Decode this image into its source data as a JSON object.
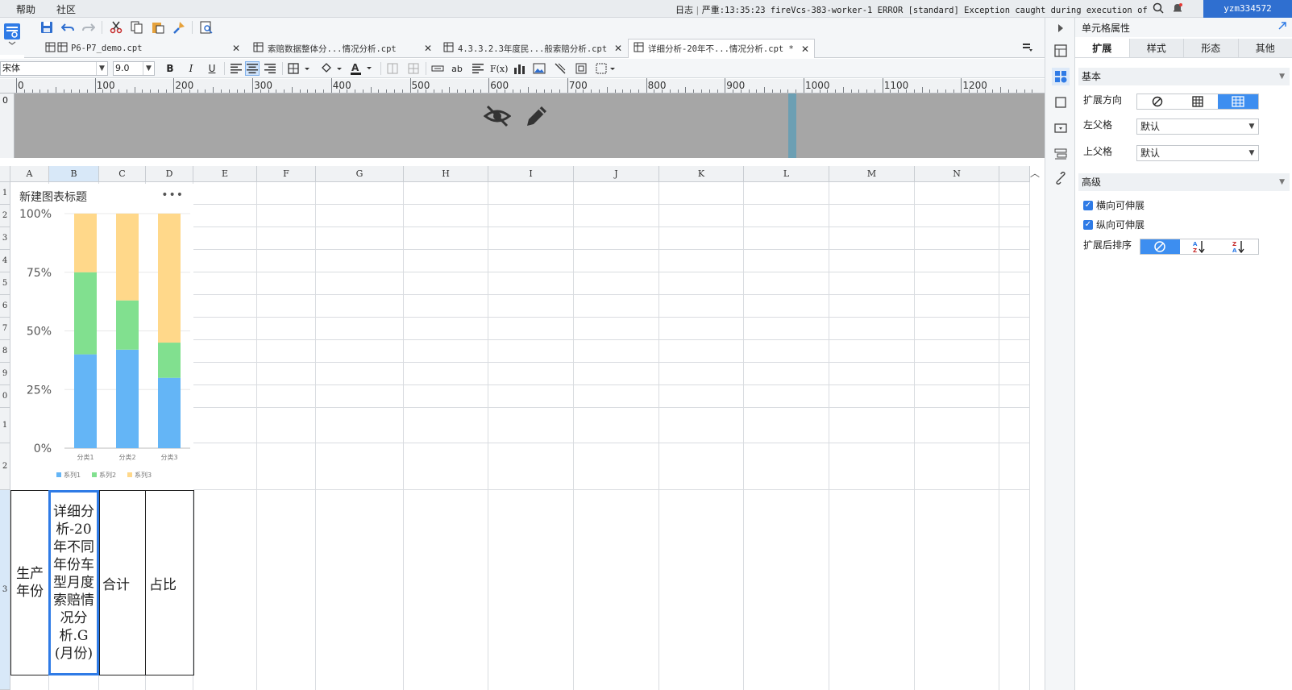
{
  "menu": {
    "help": "帮助",
    "community": "社区"
  },
  "status": {
    "log_label": "日志",
    "severity": "严重",
    "log_message": ":13:35:23 fireVcs-383-worker-1 ERROR [standard] Exception caught during execution of a...",
    "user": "yzm334572"
  },
  "tabs": [
    {
      "name": "P6-P7_demo.cpt",
      "close": "✕"
    },
    {
      "name": "索赔数据整体分...情况分析.cpt",
      "close": "✕"
    },
    {
      "name": "4.3.3.2.3年度民...般索赔分析.cpt",
      "close": "✕"
    },
    {
      "name": "详细分析-20年不...情况分析.cpt *",
      "close": "✕"
    }
  ],
  "format": {
    "font_name": "宋体",
    "font_size": "9.0",
    "bold": "B",
    "italic": "I",
    "underline": "U",
    "abc": "ab",
    "fx": "F(x)"
  },
  "ruler": {
    "marks": [
      "0",
      "100",
      "200",
      "300",
      "400",
      "500",
      "600",
      "700",
      "800",
      "900",
      "1000",
      "1100",
      "1200"
    ],
    "vzero": "0"
  },
  "grid": {
    "columns": [
      "A",
      "B",
      "C",
      "D",
      "E",
      "F",
      "G",
      "H",
      "I",
      "J",
      "K",
      "L",
      "M",
      "N"
    ],
    "rows": [
      "1",
      "2",
      "3",
      "4",
      "5",
      "6",
      "7",
      "8",
      "9",
      "0",
      "1",
      "2",
      "3"
    ]
  },
  "chart_data": {
    "type": "bar",
    "stacked": "percent",
    "title": "新建图表标题",
    "menu_glyph": "•••",
    "categories": [
      "分类1",
      "分类2",
      "分类3"
    ],
    "series": [
      {
        "name": "系列1",
        "values": [
          40,
          42,
          30
        ],
        "color": "#64b5f6"
      },
      {
        "name": "系列2",
        "values": [
          35,
          21,
          15
        ],
        "color": "#81e08f"
      },
      {
        "name": "系列3",
        "values": [
          25,
          37,
          55
        ],
        "color": "#ffd88a"
      }
    ],
    "yticks": [
      "0%",
      "25%",
      "50%",
      "75%",
      "100%"
    ],
    "ylim": [
      0,
      100
    ],
    "legend": "bottom"
  },
  "cells": {
    "a13": "生产年份",
    "b13": "详细分析-20年不同年份车型月度索赔情况分析.G(月份)",
    "c13": "合计",
    "d13": "占比"
  },
  "panel": {
    "title": "单元格属性",
    "tabs": [
      "扩展",
      "样式",
      "形态",
      "其他"
    ],
    "basic": "基本",
    "expand_dir": "扩展方向",
    "left_parent": "左父格",
    "left_parent_value": "默认",
    "up_parent": "上父格",
    "up_parent_value": "默认",
    "advanced": "高级",
    "h_expand": "横向可伸展",
    "v_expand": "纵向可伸展",
    "sort_after": "扩展后排序"
  },
  "colors": {
    "accent": "#2f7be6",
    "selected_blue": "#3d8ef0",
    "band_gray": "#a6a6a6"
  }
}
